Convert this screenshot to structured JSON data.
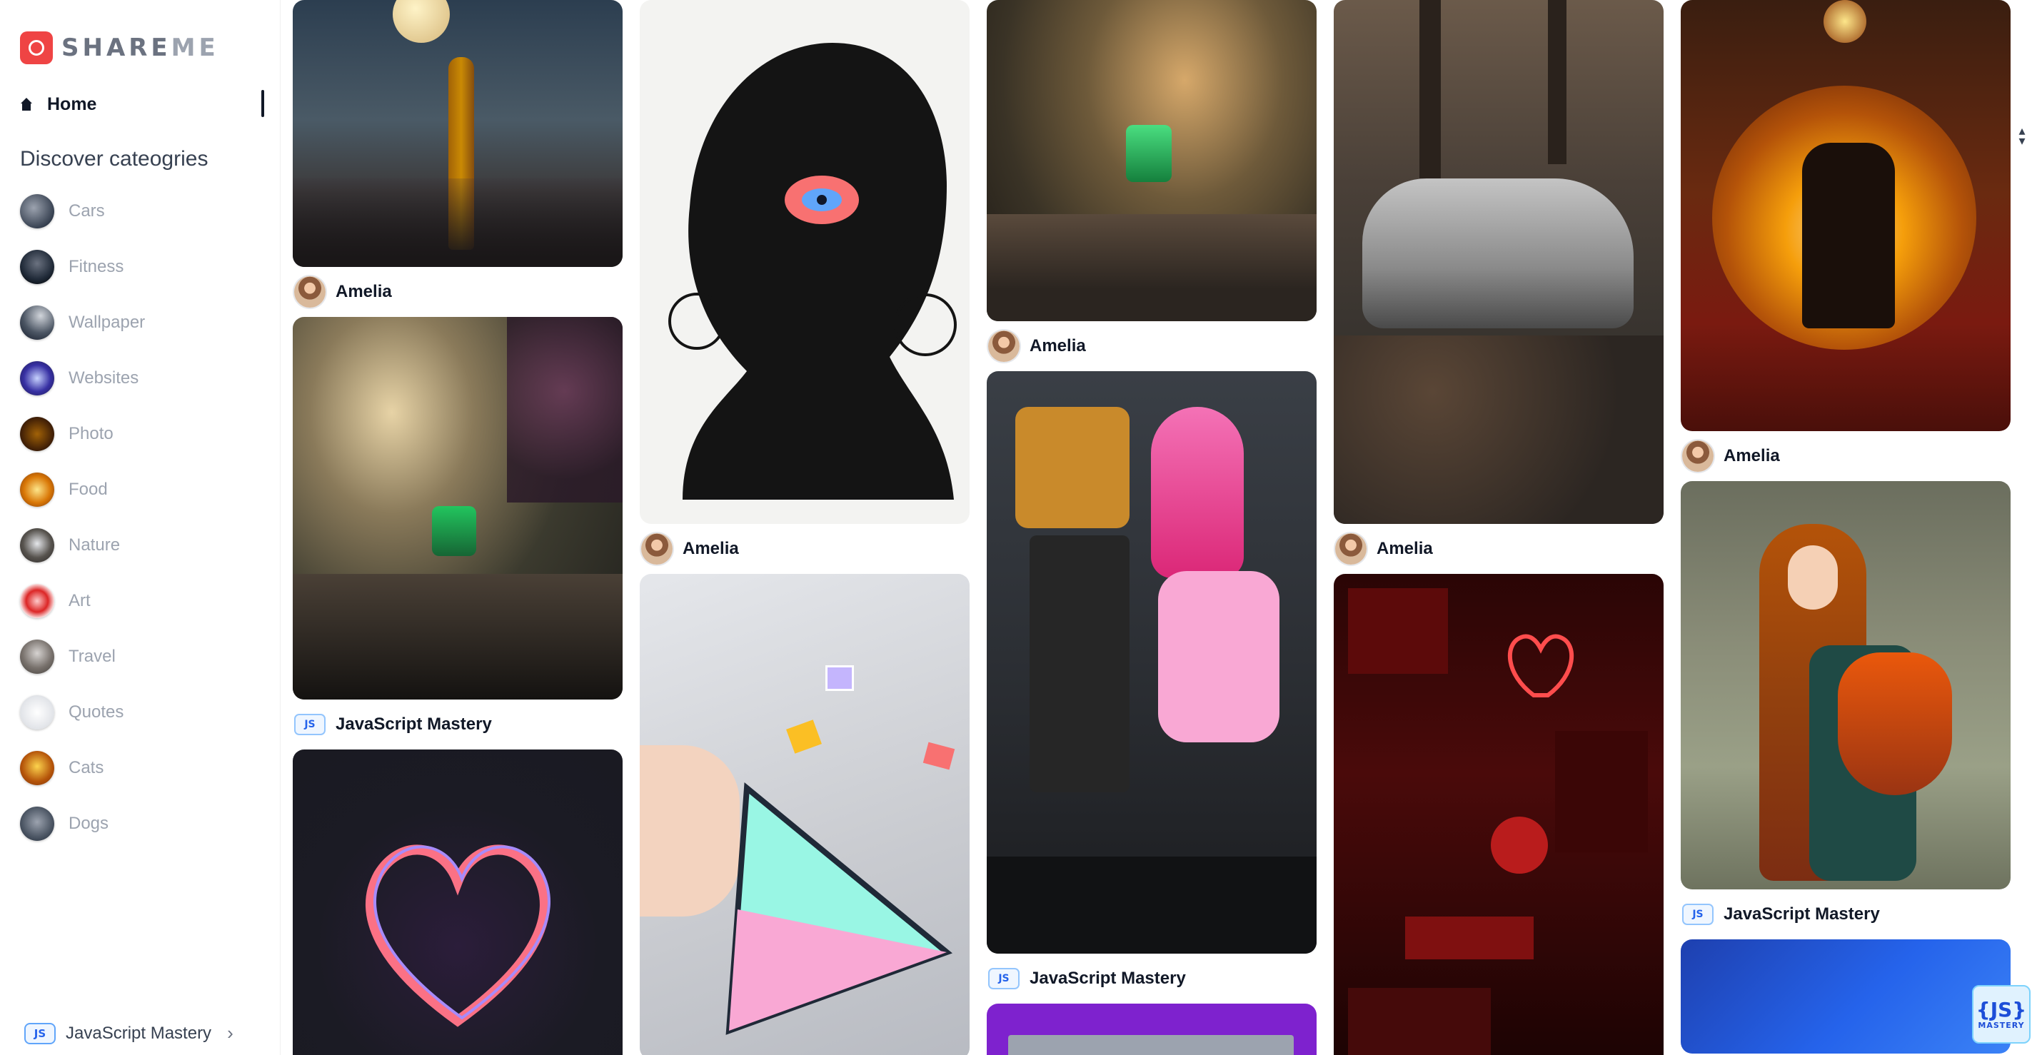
{
  "brand": {
    "name_part1": "SHARE",
    "name_part2": "ME",
    "logo_icon": "camera-icon",
    "accent": "#ef4444"
  },
  "nav": {
    "home_label": "Home",
    "home_icon": "home-icon"
  },
  "sidebar": {
    "discover_title": "Discover cateogries",
    "categories": [
      {
        "label": "Cars"
      },
      {
        "label": "Fitness"
      },
      {
        "label": "Wallpaper"
      },
      {
        "label": "Websites"
      },
      {
        "label": "Photo"
      },
      {
        "label": "Food"
      },
      {
        "label": "Nature"
      },
      {
        "label": "Art"
      },
      {
        "label": "Travel"
      },
      {
        "label": "Quotes"
      },
      {
        "label": "Cats"
      },
      {
        "label": "Dogs"
      }
    ],
    "footer_user": {
      "badge": "JS",
      "name": "JavaScript Mastery",
      "chevron_icon": "chevron-right-icon"
    }
  },
  "pins": [
    {
      "author": "Amelia",
      "subject": "giraffe-moon"
    },
    {
      "author": "JavaScript Mastery",
      "subject": "scooter-street"
    },
    {
      "author": "",
      "subject": "neon-heart"
    },
    {
      "author": "Amelia",
      "subject": "face-silhouette"
    },
    {
      "author": "",
      "subject": "stained-glass-triangle"
    },
    {
      "author": "Amelia",
      "subject": "scooter-bokeh"
    },
    {
      "author": "JavaScript Mastery",
      "subject": "spongebob-patrick"
    },
    {
      "author": "",
      "subject": "purple-card"
    },
    {
      "author": "Amelia",
      "subject": "sports-car"
    },
    {
      "author": "",
      "subject": "red-neon-collage"
    },
    {
      "author": "Amelia",
      "subject": "couple-sunset"
    },
    {
      "author": "JavaScript Mastery",
      "subject": "girl-with-fox"
    },
    {
      "author": "",
      "subject": "blue-gradient"
    }
  ],
  "watermark": {
    "big": "{JS}",
    "small": "MASTERY"
  }
}
